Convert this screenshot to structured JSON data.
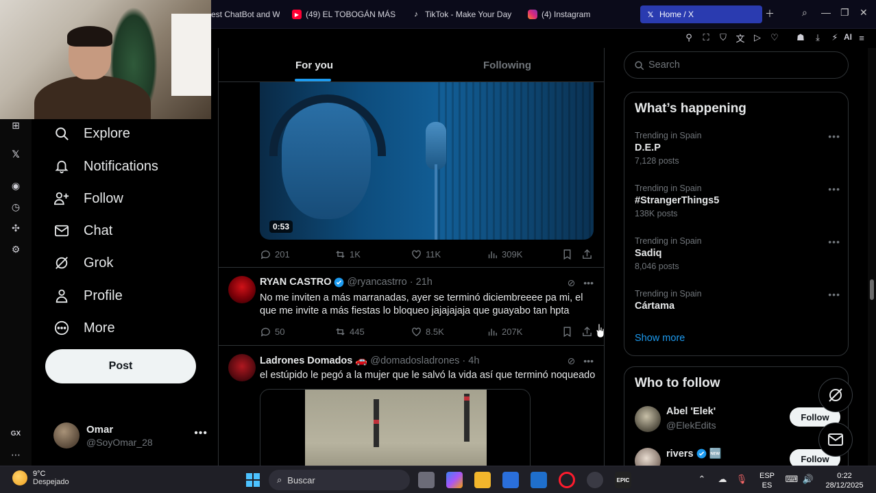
{
  "browser": {
    "tabs": [
      {
        "label": "est ChatBot and W",
        "icon": "chatbot-icon",
        "color": "#c8c8c8"
      },
      {
        "label": "(49) EL TOBOGÁN MÁS",
        "icon": "youtube-icon",
        "color": "#ff0033"
      },
      {
        "label": "TikTok - Make Your Day",
        "icon": "tiktok-icon",
        "color": "#ffffff"
      },
      {
        "label": "(4) Instagram",
        "icon": "instagram-icon",
        "color": "#e1306c"
      },
      {
        "label": "Home / X",
        "icon": "x-logo-icon",
        "color": "#ffffff"
      }
    ],
    "ai_label": "AI"
  },
  "nav": {
    "items": [
      {
        "label": "Explore",
        "icon": "search-icon"
      },
      {
        "label": "Notifications",
        "icon": "bell-icon"
      },
      {
        "label": "Follow",
        "icon": "add-person-icon"
      },
      {
        "label": "Chat",
        "icon": "mail-icon"
      },
      {
        "label": "Grok",
        "icon": "grok-icon"
      },
      {
        "label": "Profile",
        "icon": "person-icon"
      },
      {
        "label": "More",
        "icon": "more-circle-icon"
      }
    ],
    "post_label": "Post",
    "account": {
      "name": "Omar",
      "handle": "@SoyOmar_28"
    }
  },
  "opera_sidebar": {
    "gx_label": "GX"
  },
  "timeline": {
    "tabs": [
      {
        "label": "For you",
        "active": true
      },
      {
        "label": "Following",
        "active": false
      }
    ],
    "video_duration": "0:53",
    "first_actions": {
      "replies": "201",
      "reposts": "1K",
      "likes": "11K",
      "views": "309K"
    },
    "tweets": [
      {
        "name": "RYAN CASTRO",
        "handle": "@ryancastrro",
        "time": "· 21h",
        "text": "No me inviten a más marranadas, ayer se terminó diciembreeee pa mi, el que me invite a más fiestas lo bloqueo jajajajaja que guayabo tan hpta",
        "actions": {
          "replies": "50",
          "reposts": "445",
          "likes": "8.5K",
          "views": "207K"
        }
      },
      {
        "name": "Ladrones Domados",
        "name_emoji": "🚗",
        "handle": "@domadosladrones",
        "time": "· 4h",
        "text": "el estúpido le pegó a la mujer que le salvó la vida así que terminó noqueado"
      }
    ]
  },
  "right": {
    "search_placeholder": "Search",
    "happening_title": "What’s happening",
    "trends": [
      {
        "context": "Trending in Spain",
        "name": "D.E.P",
        "count": "7,128 posts"
      },
      {
        "context": "Trending in Spain",
        "name": "#StrangerThings5",
        "count": "138K posts"
      },
      {
        "context": "Trending in Spain",
        "name": "Sadiq",
        "count": "8,046 posts"
      },
      {
        "context": "Trending in Spain",
        "name": "Cártama",
        "count": ""
      }
    ],
    "show_more": "Show more",
    "wtf_title": "Who to follow",
    "wtf": [
      {
        "name": "Abel 'Elek'",
        "handle": "@ElekEdits",
        "follow": "Follow"
      },
      {
        "name": "rivers",
        "handle": "",
        "follow": "Follow",
        "badge": "🆕"
      }
    ]
  },
  "taskbar": {
    "temp": "9°C",
    "weather": "Despejado",
    "search_placeholder": "Buscar",
    "lang_top": "ESP",
    "lang_bottom": "ES",
    "time": "0:22",
    "date": "28/12/2025",
    "epic_label": "EPIC"
  },
  "colors": {
    "accent": "#1d9bf0",
    "background": "#000000",
    "border": "#2f3336",
    "muted": "#71767b"
  }
}
